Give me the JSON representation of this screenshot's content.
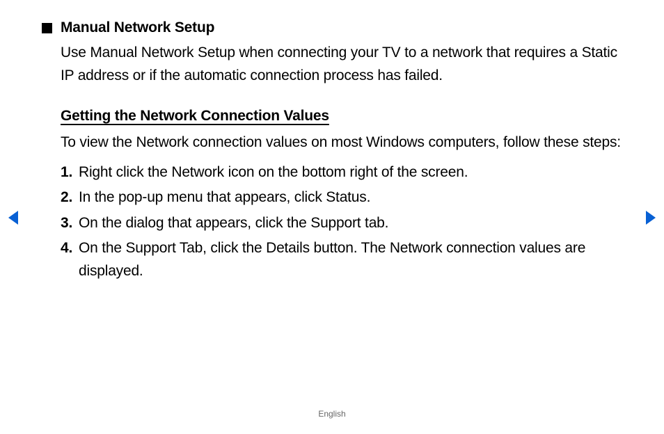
{
  "title": "Manual Network Setup",
  "intro": "Use Manual Network Setup when connecting your TV to a network that requires a Static IP address or if the automatic connection process has failed.",
  "subheading": "Getting the Network Connection Values",
  "subIntro": "To view the Network connection values on most Windows computers, follow these steps:",
  "steps": [
    {
      "num": "1.",
      "text": "Right click the Network icon on the bottom right of the screen."
    },
    {
      "num": "2.",
      "text": "In the pop-up menu that appears, click Status."
    },
    {
      "num": "3.",
      "text": "On the dialog that appears, click the Support tab."
    },
    {
      "num": "4.",
      "text": "On the Support Tab, click the Details button. The Network connection values are displayed."
    }
  ],
  "footer": {
    "language": "English"
  },
  "colors": {
    "arrow": "#0860d4"
  }
}
